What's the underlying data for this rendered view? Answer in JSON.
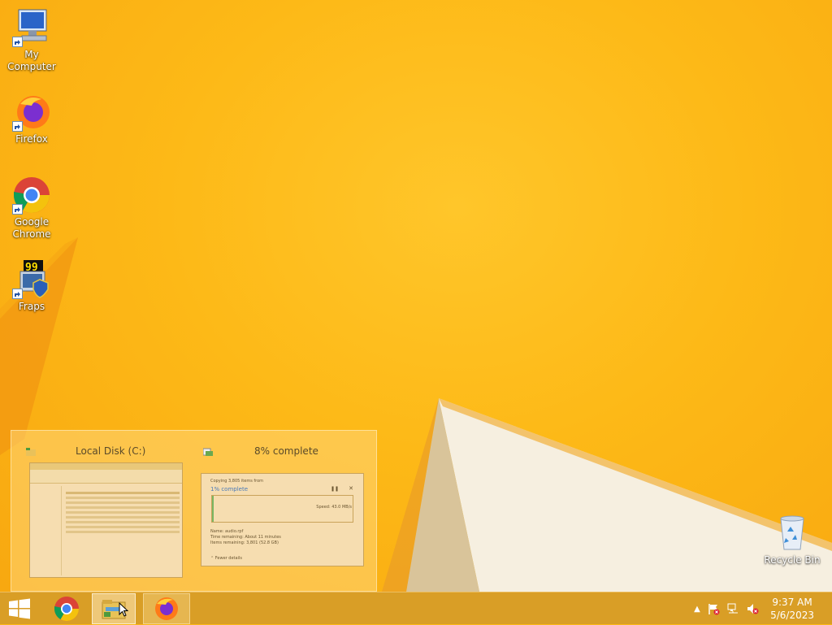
{
  "desktop": {
    "icons": [
      {
        "label": "My Computer",
        "icon": "my-computer-icon"
      },
      {
        "label": "Firefox",
        "icon": "firefox-icon"
      },
      {
        "label_line1": "Google",
        "label_line2": "Chrome",
        "icon": "chrome-icon"
      },
      {
        "label": "Fraps",
        "icon": "fraps-icon"
      },
      {
        "label": "Recycle Bin",
        "icon": "recycle-bin-icon"
      }
    ]
  },
  "taskbar_preview": {
    "window1_title": "Local Disk (C:)",
    "window2_title": "8% complete",
    "copy_dialog": {
      "header": "Copying 3,805 items from",
      "percent": "1% complete",
      "speed": "Speed: 43.0 MB/s",
      "name": "Name: audio.rpf",
      "time_remaining": "Time remaining: About 11 minutes",
      "items_remaining": "Items remaining: 3,801 (52.8 GB)",
      "fewer_details": "Fewer details",
      "progress_fraction": 0.01
    }
  },
  "taskbar": {
    "start": "windows-start-icon",
    "pinned": [
      "chrome-icon",
      "file-explorer-icon",
      "firefox-icon"
    ],
    "tray_icons": [
      "show-hidden-icons-chevron",
      "action-center-flag-icon",
      "network-icon",
      "volume-muted-icon"
    ],
    "time": "9:37 AM",
    "date": "5/6/2023"
  },
  "colors": {
    "wallpaper": "#fbb815",
    "taskbar": "#d69b28",
    "accent_white": "#f7f2e6"
  }
}
